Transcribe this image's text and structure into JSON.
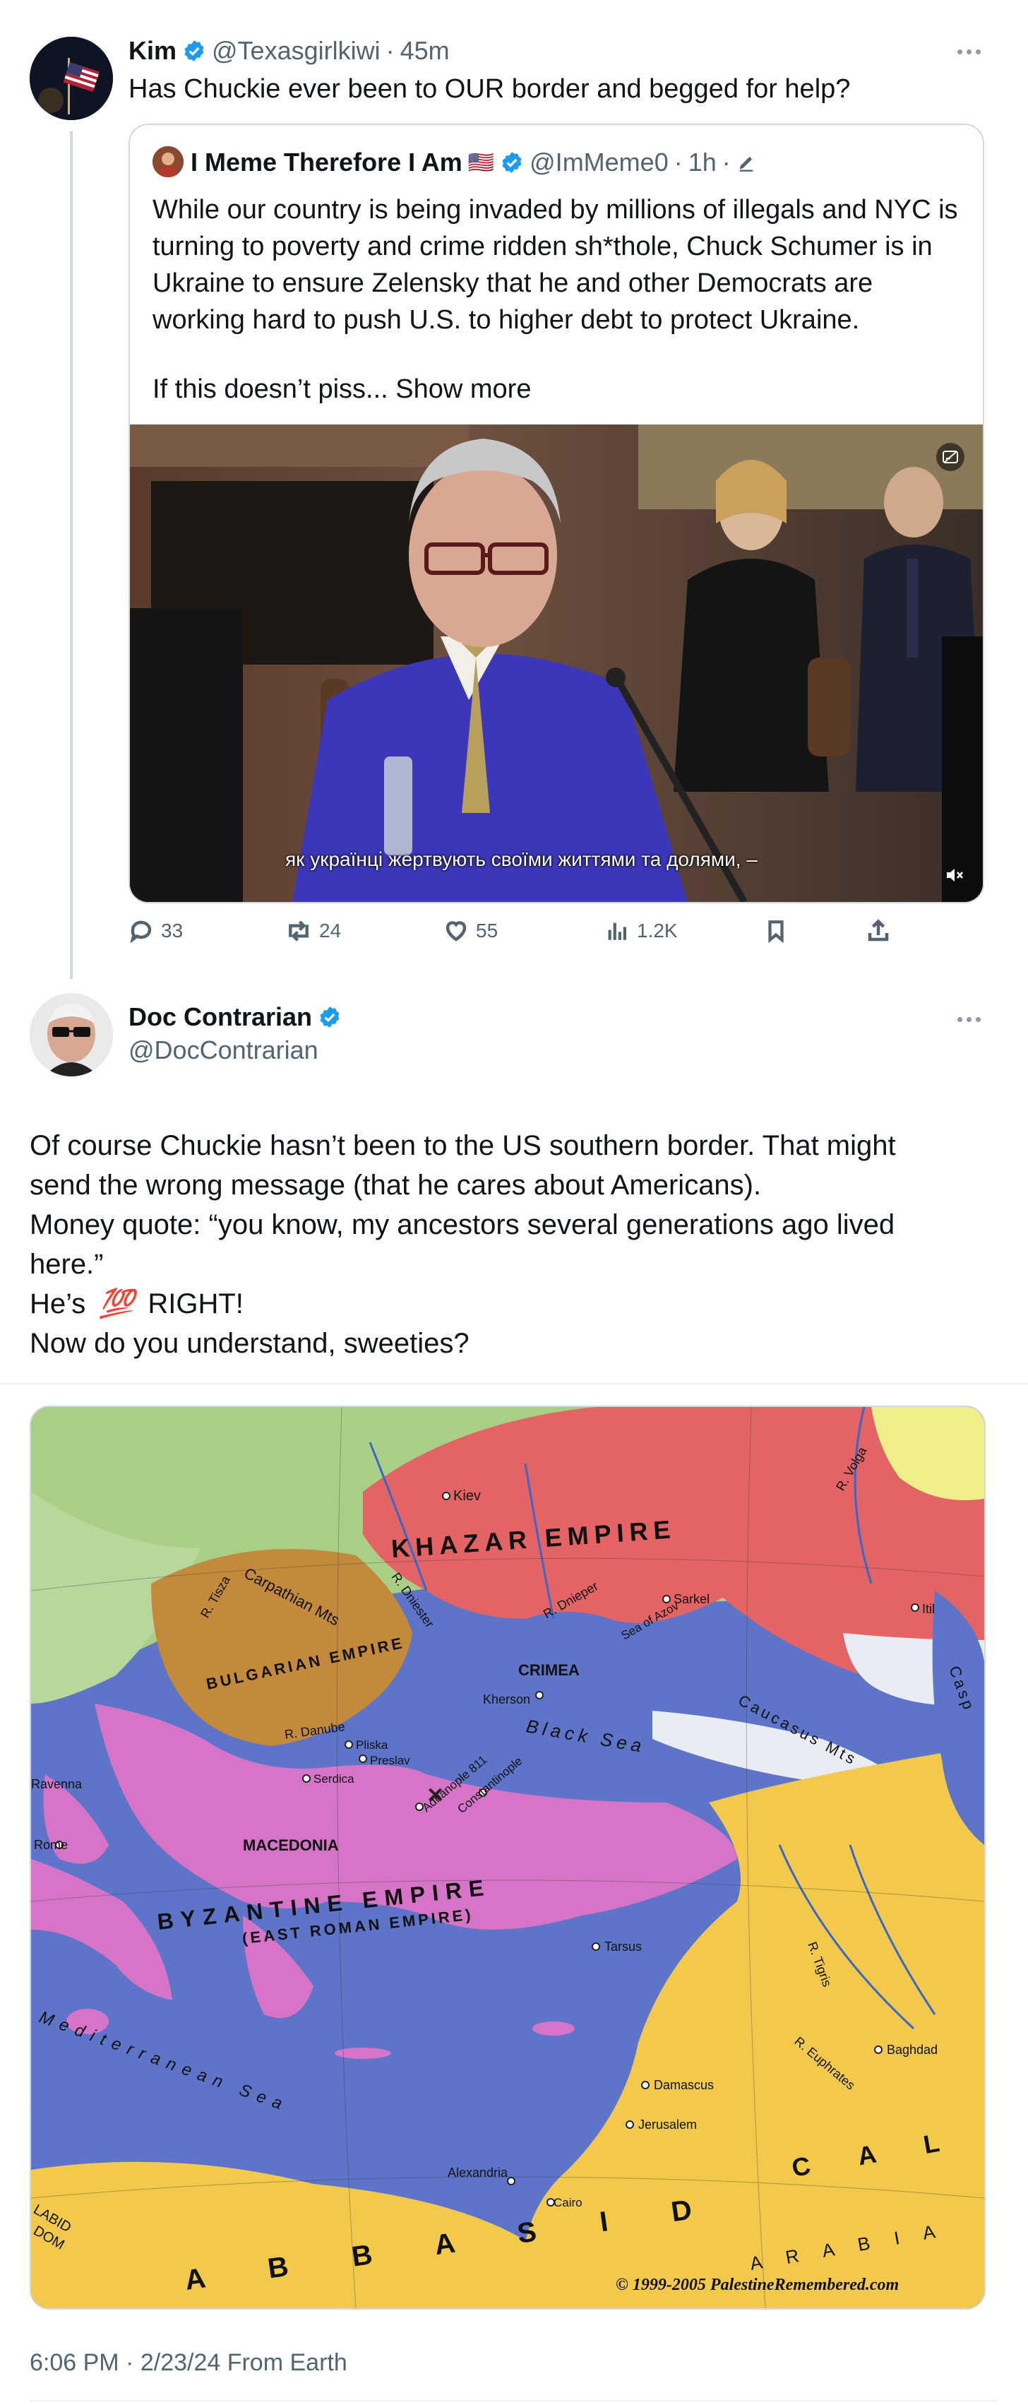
{
  "tweet1": {
    "name": "Kim",
    "handle": "@Texasgirlkiwi",
    "sep": "·",
    "time": "45m",
    "text": "Has Chuckie ever been to OUR border and begged for help?"
  },
  "quote": {
    "name": "I Meme Therefore I Am",
    "flag": "🇺🇸",
    "handle": "@ImMeme0",
    "sep1": "·",
    "time": "1h",
    "sep2": "·",
    "text": "While our country is being invaded by millions of illegals and NYC is turning to poverty and crime ridden sh*thole, Chuck Schumer is in Ukraine to ensure Zelensky that he and other Democrats are working hard to push U.S. to higher debt to protect Ukraine.",
    "text2": "If this doesn’t piss...",
    "show_more": "Show more",
    "video_caption": "як українці жертвують своїми життями та долями, –"
  },
  "actions": {
    "replies": "33",
    "reposts": "24",
    "likes": "55",
    "views": "1.2K"
  },
  "tweet2": {
    "name": "Doc Contrarian",
    "handle": "@DocContrarian",
    "lines": [
      "Of course Chuckie hasn’t been to the US southern border. That might",
      "send the wrong message (that he cares about Americans).",
      "Money quote: “you know, my ancestors several generations ago lived",
      "here.”",
      "He’s",
      "💯",
      "RIGHT!",
      "Now do you understand, sweeties?"
    ],
    "timestamp": "6:06 PM · 2/23/24 From Earth"
  },
  "map": {
    "labels": {
      "khazar": "KHAZAR EMPIRE",
      "kiev": "Kiev",
      "carpathian": "Carpathian Mts",
      "dniester": "R. Dniester",
      "dnieper": "R. Dnieper",
      "volga": "R. Volga",
      "itil": "Itil",
      "sarkel": "Sarkel",
      "azov": "Sea of Azov",
      "crimea": "CRIMEA",
      "kherson": "Kherson",
      "black_sea": "Black Sea",
      "caucasus": "Caucasus Mts",
      "caspian": "Casp",
      "tisza": "R. Tisza",
      "bulgarian": "BULGARIAN EMPIRE",
      "danube": "R. Danube",
      "pliska": "Pliska",
      "preslav": "Preslav",
      "serdica": "Serdica",
      "adrianople": "Adrianople 811",
      "constantinople": "Constantinople",
      "ravenna": "Ravenna",
      "rome": "Rome",
      "macedonia": "MACEDONIA",
      "byzantine": "BYZANTINE EMPIRE",
      "east_roman": "(EAST ROMAN EMPIRE)",
      "tarsus": "Tarsus",
      "tigris": "R. Tigris",
      "baghdad": "Baghdad",
      "euphrates": "R. Euphrates",
      "damascus": "Damascus",
      "jerusalem": "Jerusalem",
      "mediterranean": "Mediterranean Sea",
      "alexandria": "Alexandria",
      "cairo": "Cairo",
      "abbasid": "A B B A S I D",
      "arabia": "A R A B I A",
      "cal": "C A L",
      "labid": "LABID",
      "dom": "DOM",
      "copyright": "© 1999-2005 PalestineRemembered.com"
    }
  },
  "colors": {
    "accent": "#1d9bf0",
    "secondary_text": "#536471",
    "divider": "#cfd9de"
  }
}
